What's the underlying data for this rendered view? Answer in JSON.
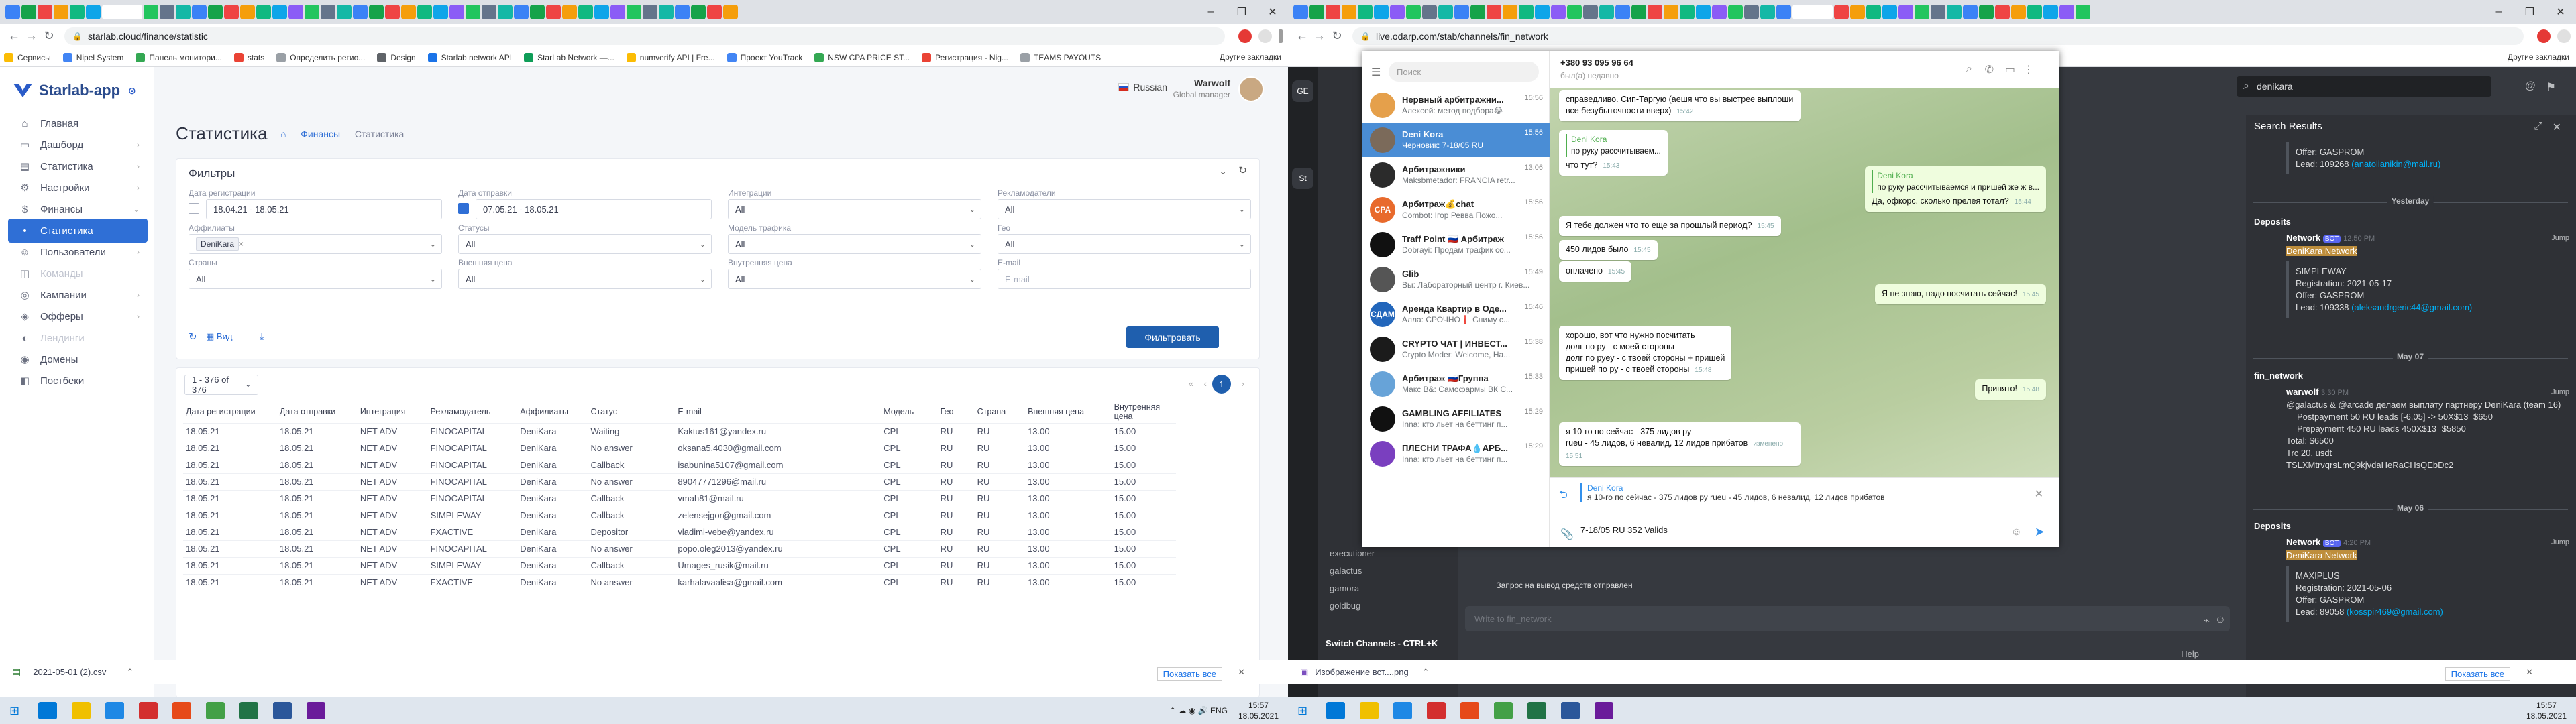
{
  "left_browser": {
    "url": "starlab.cloud/finance/statistic",
    "bookmarks": [
      "Сервисы",
      "Nipel System",
      "Панель монитори...",
      "stats",
      "Определить регио...",
      "Design",
      "Starlab network API",
      "StarLab Network —...",
      "numverify API | Fre...",
      "Проект YouTrack",
      "NSW CPA PRICE ST...",
      "Регистрация - Nig...",
      "TEAMS PAYOUTS"
    ],
    "bookmarks_right": "Другие закладки"
  },
  "app": {
    "logo": "Starlab-app",
    "lang": "Russian",
    "user_name": "Warwolf",
    "user_role": "Global manager",
    "nav": [
      {
        "icon": "⌂",
        "label": "Главная",
        "muted": false,
        "active": false,
        "chev": ""
      },
      {
        "icon": "▭",
        "label": "Дашборд",
        "muted": false,
        "active": false,
        "chev": "›"
      },
      {
        "icon": "▤",
        "label": "Статистика",
        "muted": false,
        "active": false,
        "chev": "›"
      },
      {
        "icon": "⚙",
        "label": "Настройки",
        "muted": false,
        "active": false,
        "chev": "›"
      },
      {
        "icon": "$",
        "label": "Финансы",
        "muted": false,
        "active": false,
        "chev": "⌄"
      },
      {
        "icon": "•",
        "label": "Статистика",
        "muted": false,
        "active": true,
        "chev": ""
      },
      {
        "icon": "☺",
        "label": "Пользователи",
        "muted": false,
        "active": false,
        "chev": "›"
      },
      {
        "icon": "◫",
        "label": "Команды",
        "muted": true,
        "active": false,
        "chev": ""
      },
      {
        "icon": "◎",
        "label": "Кампании",
        "muted": false,
        "active": false,
        "chev": "›"
      },
      {
        "icon": "◈",
        "label": "Офферы",
        "muted": false,
        "active": false,
        "chev": "›"
      },
      {
        "icon": "◐",
        "label": "Лендинги",
        "muted": true,
        "active": false,
        "chev": ""
      },
      {
        "icon": "◉",
        "label": "Домены",
        "muted": false,
        "active": false,
        "chev": ""
      },
      {
        "icon": "◧",
        "label": "Постбеки",
        "muted": false,
        "active": false,
        "chev": ""
      }
    ],
    "page_title": "Статистика",
    "breadcrumb": {
      "home": "⌂",
      "sep": "—",
      "finance": "Финансы",
      "current": "Статистика"
    },
    "filters": {
      "title": "Фильтры",
      "fields": [
        {
          "label": "Дата регистрации",
          "value": "18.04.21 - 18.05.21",
          "checkbox": true,
          "checked": false,
          "ph": false,
          "dd": false
        },
        {
          "label": "Дата отправки",
          "value": "07.05.21 - 18.05.21",
          "checkbox": true,
          "checked": true,
          "ph": false,
          "dd": false
        },
        {
          "label": "Интеграции",
          "value": "All",
          "checkbox": false,
          "ph": false,
          "dd": true
        },
        {
          "label": "Рекламодатели",
          "value": "All",
          "checkbox": false,
          "ph": false,
          "dd": true
        },
        {
          "label": "Аффилиаты",
          "value": "DeniKara",
          "checkbox": false,
          "ph": false,
          "dd": true,
          "tag": true
        },
        {
          "label": "Статусы",
          "value": "All",
          "checkbox": false,
          "ph": false,
          "dd": true
        },
        {
          "label": "Модель трафика",
          "value": "All",
          "checkbox": false,
          "ph": false,
          "dd": true
        },
        {
          "label": "Гео",
          "value": "All",
          "checkbox": false,
          "ph": false,
          "dd": true
        },
        {
          "label": "Страны",
          "value": "All",
          "checkbox": false,
          "ph": false,
          "dd": true
        },
        {
          "label": "Внешняя цена",
          "value": "All",
          "checkbox": false,
          "ph": false,
          "dd": true
        },
        {
          "label": "Внутренняя цена",
          "value": "All",
          "checkbox": false,
          "ph": false,
          "dd": true
        },
        {
          "label": "E-mail",
          "value": "E-mail",
          "checkbox": false,
          "ph": true,
          "dd": false
        }
      ],
      "view_label": "Вид",
      "submit": "Фильтровать"
    },
    "pagination": {
      "range": "1 - 376 of 376",
      "page": "1"
    },
    "table": {
      "columns": [
        "Дата регистрации",
        "Дата отправки",
        "Интеграция",
        "Рекламодатель",
        "Аффилиаты",
        "Статус",
        "E-mail",
        "Модель",
        "Гео",
        "Страна",
        "Внешняя цена",
        "Внутренняя цена"
      ],
      "rows": [
        [
          "18.05.21",
          "18.05.21",
          "NET ADV",
          "FINOCAPITAL",
          "DeniKara",
          "Waiting",
          "Kaktus161@yandex.ru",
          "CPL",
          "RU",
          "RU",
          "13.00",
          "15.00"
        ],
        [
          "18.05.21",
          "18.05.21",
          "NET ADV",
          "FINOCAPITAL",
          "DeniKara",
          "No answer",
          "oksana5.4030@gmail.com",
          "CPL",
          "RU",
          "RU",
          "13.00",
          "15.00"
        ],
        [
          "18.05.21",
          "18.05.21",
          "NET ADV",
          "FINOCAPITAL",
          "DeniKara",
          "Callback",
          "isabunina5107@gmail.com",
          "CPL",
          "RU",
          "RU",
          "13.00",
          "15.00"
        ],
        [
          "18.05.21",
          "18.05.21",
          "NET ADV",
          "FINOCAPITAL",
          "DeniKara",
          "No answer",
          "89047771296@mail.ru",
          "CPL",
          "RU",
          "RU",
          "13.00",
          "15.00"
        ],
        [
          "18.05.21",
          "18.05.21",
          "NET ADV",
          "FINOCAPITAL",
          "DeniKara",
          "Callback",
          "vmah81@mail.ru",
          "CPL",
          "RU",
          "RU",
          "13.00",
          "15.00"
        ],
        [
          "18.05.21",
          "18.05.21",
          "NET ADV",
          "SIMPLEWAY",
          "DeniKara",
          "Callback",
          "zelensejgor@gmail.com",
          "CPL",
          "RU",
          "RU",
          "13.00",
          "15.00"
        ],
        [
          "18.05.21",
          "18.05.21",
          "NET ADV",
          "FXACTIVE",
          "DeniKara",
          "Depositor",
          "vladimi-vebe@yandex.ru",
          "CPL",
          "RU",
          "RU",
          "13.00",
          "15.00"
        ],
        [
          "18.05.21",
          "18.05.21",
          "NET ADV",
          "FINOCAPITAL",
          "DeniKara",
          "No answer",
          "popo.oleg2013@yandex.ru",
          "CPL",
          "RU",
          "RU",
          "13.00",
          "15.00"
        ],
        [
          "18.05.21",
          "18.05.21",
          "NET ADV",
          "SIMPLEWAY",
          "DeniKara",
          "Callback",
          "Umages_rusik@mail.ru",
          "CPL",
          "RU",
          "RU",
          "13.00",
          "15.00"
        ],
        [
          "18.05.21",
          "18.05.21",
          "NET ADV",
          "FXACTIVE",
          "DeniKara",
          "No answer",
          "karhalavaalisa@gmail.com",
          "CPL",
          "RU",
          "RU",
          "13.00",
          "15.00"
        ]
      ]
    },
    "download": {
      "file": "2021-05-01 (2).csv",
      "show_all": "Показать все"
    }
  },
  "right_browser": {
    "url": "live.odarp.com/stab/channels/fin_network",
    "bookmarks_right": "Другие закладки"
  },
  "telegram": {
    "search_placeholder": "Поиск",
    "phone": "+380 93 095 96 64",
    "status": "был(а) недавно",
    "chats": [
      {
        "name": "Нервный арбитражни...",
        "time": "15:56",
        "preview": "Алексей: метод подбора😂",
        "color": "#e5a04b",
        "sel": false,
        "abbr": ""
      },
      {
        "name": "Deni Kora",
        "time": "15:56",
        "preview": "Черновик: 7-18/05 RU",
        "color": "#7b6a5a",
        "sel": true,
        "abbr": ""
      },
      {
        "name": "Арбитражники",
        "time": "13:06",
        "preview": "Maksbmetador: FRANCIA retr...",
        "color": "#2b2b2b",
        "sel": false,
        "abbr": ""
      },
      {
        "name": "Арбитраж💰chat",
        "time": "15:56",
        "preview": "Combot: Ігор Ревва Пожо...",
        "color": "#e86a2c",
        "sel": false,
        "abbr": "CPA"
      },
      {
        "name": "Traff Point 🇷🇺 Арбитраж",
        "time": "15:56",
        "preview": "Dobrayi: Продам трафик со...",
        "color": "#111",
        "sel": false,
        "abbr": ""
      },
      {
        "name": "Glib",
        "time": "15:49",
        "preview": "Вы: Лабораторный центр г. Киев...",
        "color": "#555",
        "sel": false,
        "abbr": ""
      },
      {
        "name": "Аренда Квартир в Оде...",
        "time": "15:46",
        "preview": "Алла: СРОЧНО❗ Сниму с...",
        "color": "#2266bb",
        "sel": false,
        "abbr": "СДАМ"
      },
      {
        "name": "CRYPTO ЧАТ | ИНВЕСТ...",
        "time": "15:38",
        "preview": "Crypto Moder: Welcome, Ha...",
        "color": "#1b1b1b",
        "sel": false,
        "abbr": ""
      },
      {
        "name": "Арбитраж 🇷🇺Группа",
        "time": "15:33",
        "preview": "Макс В&: Самофармы ВК С...",
        "color": "#67a3d8",
        "sel": false,
        "abbr": ""
      },
      {
        "name": "GAMBLING AFFILIATES",
        "time": "15:29",
        "preview": "Inna: кто льет на беттинг п...",
        "color": "#111",
        "sel": false,
        "abbr": ""
      },
      {
        "name": "ПЛЕСНИ ТРАФА💧АРБ...",
        "time": "15:29",
        "preview": "Inna: кто льет на беттинг п...",
        "color": "#7a3fbf",
        "sel": false,
        "abbr": ""
      }
    ],
    "messages": [
      {
        "text": "справедливо. Сип-Таргую (аешя что вы выстрее выплоши все безубыточности вверх)",
        "time": "15:42",
        "out": false
      },
      {
        "reply_name": "Deni Kora",
        "reply_text": "по руку рассчитываем...",
        "text": "что тут?",
        "time": "15:43",
        "out": false
      },
      {
        "reply_name": "Deni Kora",
        "reply_text": "по руку рассчитываемся и пришей же ж в...",
        "text": "Да, офкорс. сколько прелея тотал?",
        "time": "15:44",
        "out": true
      },
      {
        "text": "Я тебе должен что то еще за прошлый период?",
        "time": "15:45",
        "out": false
      },
      {
        "text": "450 лидов было",
        "time": "15:45",
        "out": false
      },
      {
        "text": "оплачено",
        "time": "15:45",
        "out": false
      },
      {
        "text": "Я не знаю, надо посчитать сейчас!",
        "time": "15:45",
        "out": true
      },
      {
        "text": "хорошо, вот что нужно посчитать\nдолг по ру - с моей стороны\nдолг по руеу - с твоей стороны + пришей\nпришей по ру - с твоей стороны",
        "time": "15:48",
        "out": false
      },
      {
        "text": "Принято!",
        "time": "15:48",
        "out": true
      },
      {
        "text": "я 10-го по сейчас - 375 лидов ру\nrueu - 45 лидов, 6 невалид, 12 лидов прибатов",
        "time": "изменено 15:51",
        "out": false
      }
    ],
    "reply_name": "Deni Kora",
    "reply_text": "я 10-го по сейчас - 375 лидов ру rueu - 45 лидов, 6 невалид, 12 лидов прибатов",
    "draft": "7-18/05 RU 352 Valids"
  },
  "discord": {
    "channels": [
      "executioner",
      "galactus",
      "gamora",
      "goldbug"
    ],
    "switch": "Switch Channels - CTRL+K",
    "input_placeholder": "Write to fin_network",
    "search_query": "denikara",
    "search_title": "Search Results",
    "transfer_text": "Запрос на вывод средств отправлен",
    "help": "Help"
  },
  "search_results": {
    "top": {
      "offer": "Offer: GASPROM",
      "lead": "Lead: 109268",
      "email": "(anatolianikin@mail.ru)"
    },
    "sep1": "Yesterday",
    "res1": {
      "channel": "Deposits",
      "author": "Network",
      "bot": "BOT",
      "time": "12:50 PM",
      "jump": "Jump",
      "title": "DeniKara Network",
      "brand": "SIMPLEWAY",
      "reg": "Registration: 2021-05-17",
      "offer": "Offer: GASPROM",
      "lead": "Lead: 109338",
      "email": "(aleksandrgeric44@gmail.com)"
    },
    "sep2": "May 07",
    "res2": {
      "channel": "fin_network",
      "author": "warwolf",
      "time": "3:30 PM",
      "jump": "Jump",
      "msg": "@galactus & @arcade делаем выплату партнеру DeniKara (team 16)",
      "li1": "Postpayment 50 RU leads [-6.05] -> 50X$13=$650",
      "li2": "Prepayment 450 RU leads 450X$13=$5850",
      "total": "Total: $6500",
      "trc": "Trc 20, usdt",
      "wallet": "TSLXMtrvqrsLmQ9kjvdaHeRaCHsQEbDc2"
    },
    "sep3": "May 06",
    "res3": {
      "channel": "Deposits",
      "author": "Network",
      "bot": "BOT",
      "time": "4:20 PM",
      "jump": "Jump",
      "title": "DeniKara Network",
      "brand": "MAXIPLUS",
      "reg": "Registration: 2021-05-06",
      "offer": "Offer: GASPROM",
      "lead": "Lead: 89058",
      "email": "(kosspir469@gmail.com)"
    }
  },
  "taskbar": {
    "lang": "ENG",
    "time": "15:57",
    "date": "18.05.2021"
  },
  "download_right": {
    "file": "Изображение вст....png",
    "show_all": "Показать все"
  }
}
